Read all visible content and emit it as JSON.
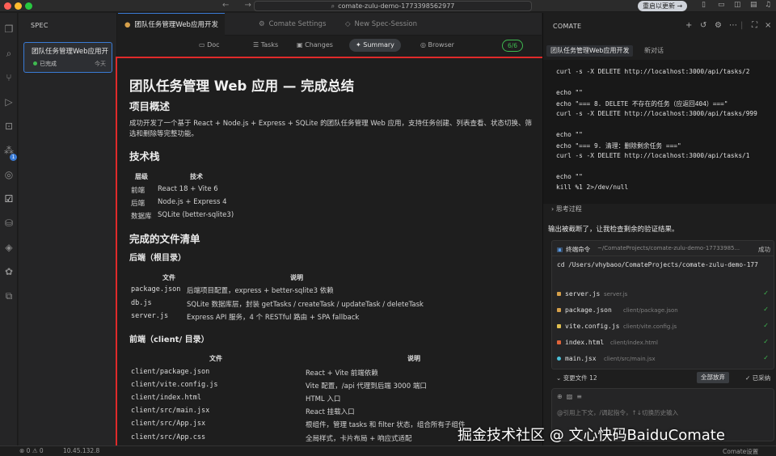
{
  "titlebar": {
    "nav": "← →",
    "search_text": "comate-zulu-demo-1773398562977",
    "update_button": "重启以更新 →"
  },
  "sidebar": {
    "title": "SPEC",
    "card": {
      "title": "团队任务管理Web应用开发",
      "status": "已完成",
      "time": "今天"
    }
  },
  "editor_tabs": [
    {
      "label": "团队任务管理Web应用开发",
      "active": true
    },
    {
      "label": "Comate Settings",
      "active": false
    },
    {
      "label": "New Spec-Session",
      "active": false
    }
  ],
  "view_toolbar": {
    "buttons": [
      "Doc",
      "Tasks",
      "Changes",
      "Summary",
      "Browser"
    ],
    "active": "Summary",
    "progress": "6/6"
  },
  "document": {
    "title": "团队任务管理 Web 应用 — 完成总结",
    "overview_heading": "项目概述",
    "overview_text": "成功开发了一个基于 React + Node.js + Express + SQLite 的团队任务管理 Web 应用，支持任务创建、列表查看、状态切换、筛选和删除等完整功能。",
    "tech_heading": "技术栈",
    "tech_table": {
      "headers": [
        "层级",
        "技术"
      ],
      "rows": [
        [
          "前端",
          "React 18 + Vite 6"
        ],
        [
          "后端",
          "Node.js + Express 4"
        ],
        [
          "数据库",
          "SQLite (better-sqlite3)"
        ]
      ]
    },
    "files_heading": "完成的文件清单",
    "backend_heading": "后端（根目录）",
    "backend_table": {
      "headers": [
        "文件",
        "说明"
      ],
      "rows": [
        [
          "package.json",
          "后端项目配置，express + better-sqlite3 依赖"
        ],
        [
          "db.js",
          "SQLite 数据库层，封装 getTasks / createTask / updateTask / deleteTask"
        ],
        [
          "server.js",
          "Express API 服务，4 个 RESTful 路由 + SPA fallback"
        ]
      ]
    },
    "frontend_heading": "前端（client/ 目录）",
    "frontend_table": {
      "headers": [
        "文件",
        "说明"
      ],
      "rows": [
        [
          "client/package.json",
          "React + Vite 前端依赖"
        ],
        [
          "client/vite.config.js",
          "Vite 配置，/api 代理到后端 3000 端口"
        ],
        [
          "client/index.html",
          "HTML 入口"
        ],
        [
          "client/src/main.jsx",
          "React 挂载入口"
        ],
        [
          "client/src/App.jsx",
          "根组件，管理 tasks 和 filter 状态，组合所有子组件"
        ],
        [
          "client/src/App.css",
          "全局样式，卡片布局 + 响应式适配"
        ]
      ]
    }
  },
  "right_panel": {
    "title": "COMATE",
    "tabs": [
      "团队任务管理Web应用开发",
      "新对话"
    ],
    "terminal_lines": [
      "curl -s -X DELETE http://localhost:3000/api/tasks/2",
      "",
      "echo \"\"",
      "echo \"=== 8. DELETE 不存在的任务（应返回404）===\"",
      "curl -s -X DELETE http://localhost:3000/api/tasks/999",
      "",
      "echo \"\"",
      "echo \"=== 9. 清理：删除剩余任务 ===\"",
      "curl -s -X DELETE http://localhost:3000/api/tasks/1",
      "",
      "echo \"\"",
      "kill %1 2>/dev/null"
    ],
    "thinking": "思考过程",
    "message": "输出被截断了，让我检查剩余的验证结果。",
    "command_card": {
      "label": "终端命令",
      "path": "~/ComateProjects/comate-zulu-demo-17733985...",
      "status": "成功",
      "command": "cd /Users/vhybaoo/ComateProjects/comate-zulu-demo-177",
      "files": [
        {
          "name": "server.js",
          "path": "server.js",
          "color": "#d6a04a"
        },
        {
          "name": "package.json",
          "path": "client/package.json",
          "color": "#d6a04a"
        },
        {
          "name": "vite.config.js",
          "path": "client/vite.config.js",
          "color": "#e0c050"
        },
        {
          "name": "index.html",
          "path": "client/index.html",
          "color": "#e0643a"
        },
        {
          "name": "main.jsx",
          "path": "client/src/main.jsx",
          "color": "#4ac0d8"
        }
      ]
    },
    "changes": {
      "label": "变更文件 12",
      "discard": "全部放弃",
      "adopted": "已采纳"
    },
    "input_placeholder": "@引用上下文，/调起指令，↑↓切换历史输入"
  },
  "statusbar": {
    "problems": "⊗ 0 ⚠ 0",
    "position": "10.45.132.8",
    "settings": "Comate设置"
  },
  "watermark": "掘金技术社区 @ 文心快码BaiduComate"
}
